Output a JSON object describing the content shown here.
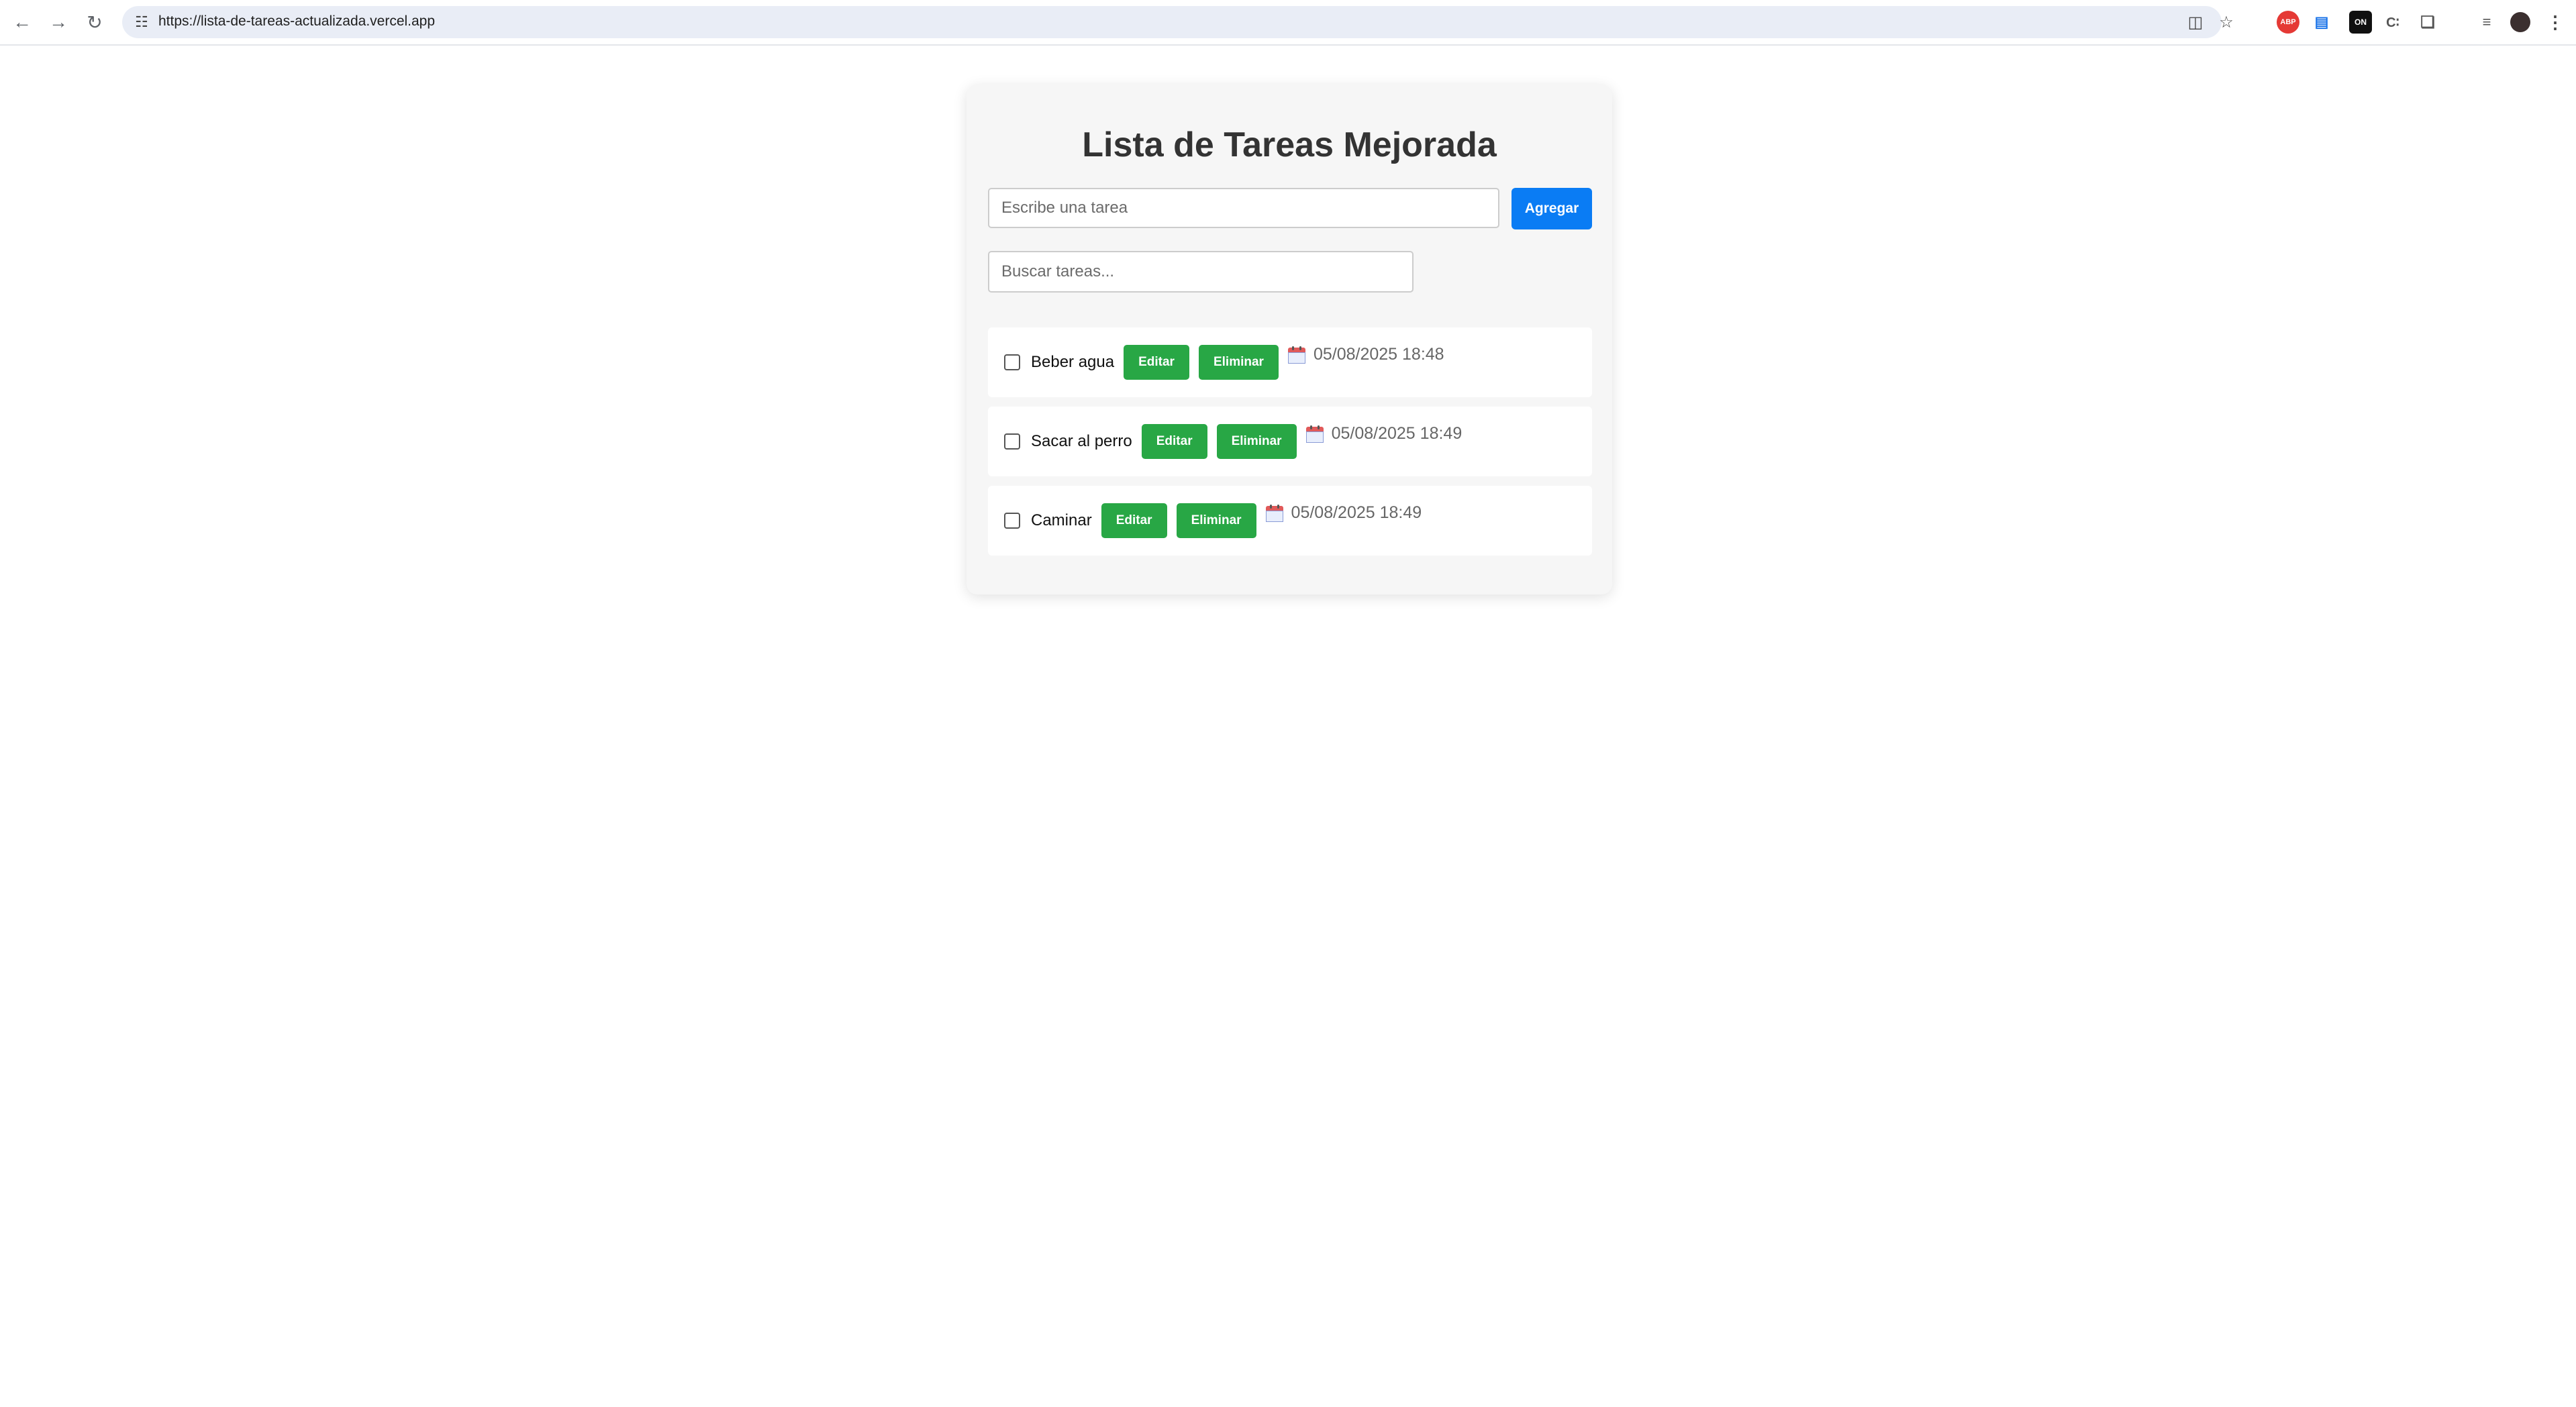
{
  "browser": {
    "url": "https://lista-de-tareas-actualizada.vercel.app",
    "extensions": [
      "adblock-icon",
      "translate-icon",
      "extension-icon",
      "extension-icon-2",
      "puzzle-icon",
      "media-icon",
      "profile-avatar",
      "menu-icon"
    ]
  },
  "app": {
    "title": "Lista de Tareas Mejorada",
    "new_task_placeholder": "Escribe una tarea",
    "add_label": "Agregar",
    "search_placeholder": "Buscar tareas...",
    "colors": {
      "primary": "#0a7cf4",
      "success": "#28a745",
      "card_bg": "#f6f6f6"
    }
  },
  "tasks": [
    {
      "text": "Beber agua",
      "edit_label": "Editar",
      "delete_label": "Eliminar",
      "date": "05/08/2025 18:48",
      "done": false
    },
    {
      "text": "Sacar al perro",
      "edit_label": "Editar",
      "delete_label": "Eliminar",
      "date": "05/08/2025 18:49",
      "done": false
    },
    {
      "text": "Caminar",
      "edit_label": "Editar",
      "delete_label": "Eliminar",
      "date": "05/08/2025 18:49",
      "done": false
    }
  ]
}
